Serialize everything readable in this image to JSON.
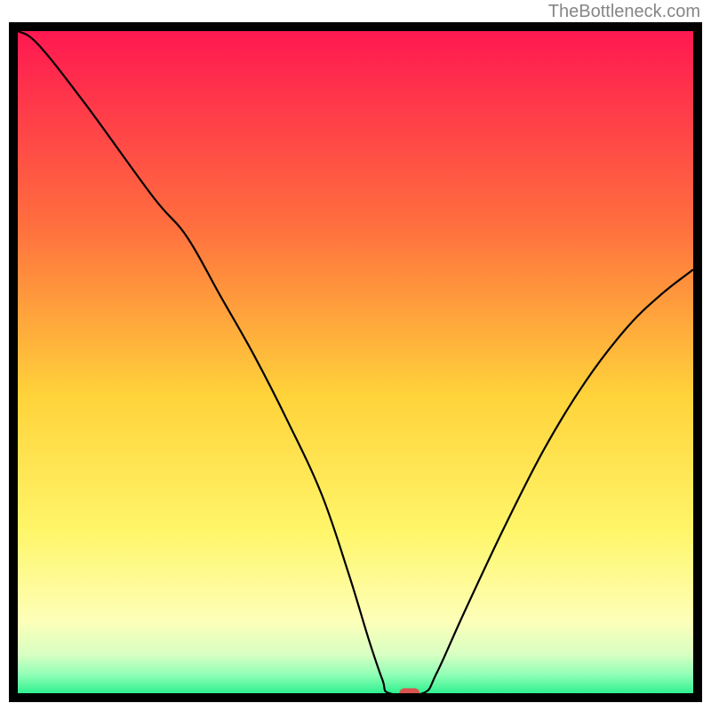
{
  "watermark": "TheBottleneck.com",
  "chart_data": {
    "type": "line",
    "title": "",
    "xlabel": "",
    "ylabel": "",
    "xlim": [
      0,
      100
    ],
    "ylim": [
      0,
      100
    ],
    "background": {
      "type": "vertical_gradient",
      "stops": [
        {
          "offset": 0,
          "color": "#ff1452"
        },
        {
          "offset": 30,
          "color": "#ff6f3e"
        },
        {
          "offset": 55,
          "color": "#ffd33a"
        },
        {
          "offset": 75,
          "color": "#fff66a"
        },
        {
          "offset": 88,
          "color": "#fdffb8"
        },
        {
          "offset": 93,
          "color": "#d8ffc3"
        },
        {
          "offset": 96,
          "color": "#8fffb5"
        },
        {
          "offset": 100,
          "color": "#00e97e"
        }
      ]
    },
    "curve": [
      {
        "x": 0,
        "y": 100
      },
      {
        "x": 3,
        "y": 98
      },
      {
        "x": 10,
        "y": 89
      },
      {
        "x": 20,
        "y": 75
      },
      {
        "x": 25,
        "y": 69
      },
      {
        "x": 30,
        "y": 60
      },
      {
        "x": 35,
        "y": 51
      },
      {
        "x": 40,
        "y": 41
      },
      {
        "x": 45,
        "y": 30
      },
      {
        "x": 49,
        "y": 18
      },
      {
        "x": 52,
        "y": 8
      },
      {
        "x": 54,
        "y": 2
      },
      {
        "x": 55,
        "y": 0
      },
      {
        "x": 60,
        "y": 0
      },
      {
        "x": 62,
        "y": 3
      },
      {
        "x": 66,
        "y": 12
      },
      {
        "x": 72,
        "y": 25
      },
      {
        "x": 78,
        "y": 37
      },
      {
        "x": 84,
        "y": 47
      },
      {
        "x": 90,
        "y": 55
      },
      {
        "x": 95,
        "y": 60
      },
      {
        "x": 100,
        "y": 64
      }
    ],
    "marker": {
      "x": 58,
      "y": 0,
      "width": 3,
      "height": 1.5,
      "color": "#d9534f"
    },
    "frame_color": "#000000"
  }
}
